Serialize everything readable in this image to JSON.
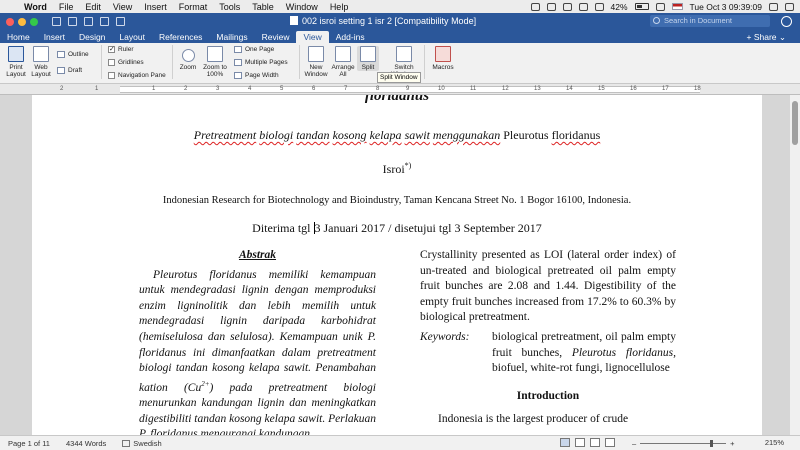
{
  "menubar": {
    "app_name": "Word",
    "items": [
      "File",
      "Edit",
      "View",
      "Insert",
      "Format",
      "Tools",
      "Table",
      "Window",
      "Help"
    ],
    "battery": "42%",
    "datetime": "Tue Oct 3  09:39:09"
  },
  "titlebar": {
    "title": "002 isroi  setting 1 isr 2 [Compatibility Mode]",
    "search_placeholder": "Search in Document"
  },
  "tabs": [
    "Home",
    "Insert",
    "Design",
    "Layout",
    "References",
    "Mailings",
    "Review",
    "View",
    "Add-ins"
  ],
  "active_tab": "View",
  "share_label": "Share",
  "ribbon": {
    "print_layout": "Print Layout",
    "web_layout": "Web Layout",
    "outline": "Outline",
    "draft": "Draft",
    "ruler": "Ruler",
    "ruler_checked": true,
    "gridlines": "Gridlines",
    "gridlines_checked": false,
    "nav_pane": "Navigation Pane",
    "nav_pane_checked": false,
    "zoom": "Zoom",
    "zoom_100": "Zoom to 100%",
    "one_page": "One Page",
    "multiple_pages": "Multiple Pages",
    "page_width": "Page Width",
    "new_window": "New Window",
    "arrange_all": "Arrange All",
    "split": "Split",
    "switch_windows": "Switch Windows",
    "macros": "Macros",
    "tooltip": "Split Window"
  },
  "ruler_numbers": [
    "2",
    "1",
    "1",
    "2",
    "3",
    "4",
    "5",
    "6",
    "7",
    "8",
    "9",
    "10",
    "11",
    "12",
    "13",
    "14",
    "15",
    "16",
    "17",
    "18"
  ],
  "document": {
    "cut_title": "floridanus",
    "subtitle_words": [
      "Pretreatment",
      "biologi",
      "tandan",
      "kosong",
      "kelapa",
      "sawit",
      "menggunakan",
      "Pleurotus",
      "floridanus"
    ],
    "author": "Isroi",
    "author_sup": "*)",
    "affiliation": "Indonesian Research for Biotechnology and Bioindustry, Taman Kencana Street No. 1 Bogor 16100, Indonesia.",
    "dates_before_cursor": "Diterima tgl ",
    "dates_after_cursor": "3 Januari 2017  / disetujui tgl 3 September 2017",
    "abstract_title": "Abstrak",
    "abstract_text_1": "Pleurotus floridanus memiliki kemampuan untuk mendegradasi lignin dengan memproduksi enzim ligninolitik dan lebih memilih untuk mendegradasi lignin daripada karbohidrat (hemiselulosa dan selulosa). Kemampuan unik P. floridanus ini dimanfaatkan dalam pretreatment biologi tandan kosong kelapa sawit. Penambahan kation (Cu",
    "abstract_sup": "2+",
    "abstract_text_2": ") pada pretreatment biologi menurunkan kandungan lignin dan meningkatkan digestibiliti tandan kosong kelapa sawit. Perlakuan P. floridanus mengurangi kandungan",
    "right_abstract": "Crystallinity presented as LOI (lateral order index) of un-treated and biological pretreated oil palm empty fruit bunches are 2.08 and 1.44. Digestibility of the empty fruit bunches increased from 17.2% to 60.3% by biological pretreatment.",
    "keywords_label": "Keywords",
    "keywords_before_italic": "biological pretreatment, oil palm empty fruit bunches, ",
    "keywords_italic": "Pleurotus floridanus,",
    "keywords_after_italic": " biofuel, white-rot fungi, lignocellulose",
    "intro_title": "Introduction",
    "intro_text": "Indonesia is the largest producer of crude"
  },
  "statusbar": {
    "page": "Page 1 of 11",
    "words": "4344 Words",
    "language": "Swedish",
    "zoom": "215%"
  }
}
